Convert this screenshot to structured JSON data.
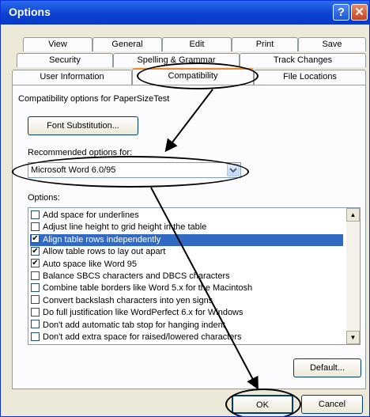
{
  "window": {
    "title": "Options",
    "help_glyph": "?",
    "close_glyph": "✕"
  },
  "tabs": {
    "row1": [
      "View",
      "General",
      "Edit",
      "Print",
      "Save"
    ],
    "row2": [
      "Security",
      "Spelling & Grammar",
      "Track Changes"
    ],
    "row3": [
      "User Information",
      "Compatibility",
      "File Locations"
    ]
  },
  "compat": {
    "heading": "Compatibility options for PaperSizeTest",
    "font_sub_button": "Font Substitution...",
    "recommended_label": "Recommended options for:",
    "recommended_value": "Microsoft Word 6.0/95",
    "options_label": "Options:",
    "options": [
      {
        "label": "Add space for underlines",
        "checked": false
      },
      {
        "label": "Adjust line height to grid height in the table",
        "checked": false
      },
      {
        "label": "Align table rows independently",
        "checked": true
      },
      {
        "label": "Allow table rows to lay out apart",
        "checked": true
      },
      {
        "label": "Auto space like Word 95",
        "checked": true
      },
      {
        "label": "Balance SBCS characters and DBCS characters",
        "checked": false
      },
      {
        "label": "Combine table borders like Word 5.x for the Macintosh",
        "checked": false
      },
      {
        "label": "Convert backslash characters into yen signs",
        "checked": false
      },
      {
        "label": "Do full justification like WordPerfect 6.x for Windows",
        "checked": false
      },
      {
        "label": "Don't add automatic tab stop for hanging indent",
        "checked": false
      },
      {
        "label": "Don't add extra space for raised/lowered characters",
        "checked": false
      }
    ],
    "default_button": "Default..."
  },
  "footer": {
    "ok": "OK",
    "cancel": "Cancel"
  }
}
